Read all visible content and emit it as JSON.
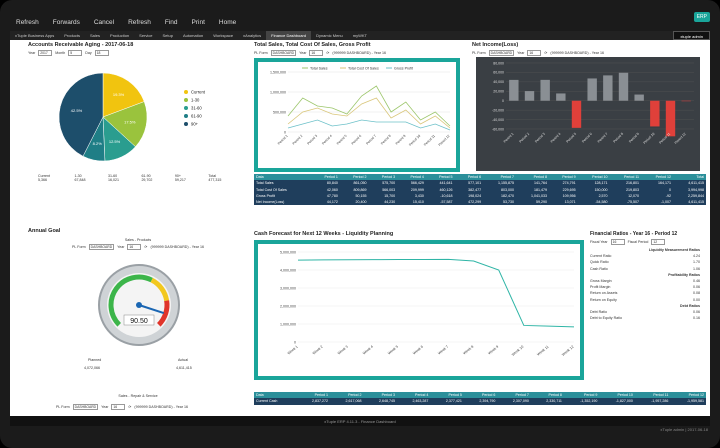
{
  "nav": {
    "refresh": "Refresh",
    "forwards": "Forwards",
    "cancel": "Cancel",
    "refresh2": "Refresh",
    "find": "Find",
    "print": "Print",
    "home": "Home"
  },
  "badge": "ERP",
  "tabs": [
    "xTuple Business Apps",
    "Products",
    "Sales",
    "Production",
    "Service",
    "Setup",
    "Automation",
    "Workspace",
    "xAnalytics",
    "Finance Dashboard",
    "Dynamic Menu",
    "myWKT"
  ],
  "user": "xtuple admin",
  "ar": {
    "title": "Accounts Receivable Aging - 2017-06-18",
    "year_label": "Year",
    "year": "2017",
    "month_label": "Month",
    "month": "5",
    "day_label": "Day",
    "day": "18",
    "legend": [
      "Current",
      "1-30",
      "31-60",
      "61-90",
      "90+"
    ],
    "slices": [
      {
        "label": "Current",
        "value": "5,366",
        "pct": "19.3%"
      },
      {
        "label": "1-30",
        "value": "67,848",
        "pct": "17.5%"
      },
      {
        "label": "31-60",
        "value": "16,021",
        "pct": "12.5%"
      },
      {
        "label": "61-90",
        "value": "29,702",
        "pct": "8.2%"
      },
      {
        "label": "90+",
        "value": "59,217",
        "pct": "42.5%"
      }
    ],
    "cols": [
      "Current",
      "1-30",
      "31-60",
      "61-90",
      "90+",
      "Total"
    ],
    "vals": [
      "5,366",
      "67,848",
      "16,021",
      "29,702",
      "59,217",
      "477,315"
    ]
  },
  "sales": {
    "title": "Total Sales, Total Cost Of Sales, Gross Profit",
    "pl_label": "PL Form",
    "pl": "DASHBOARD",
    "year_label": "Year",
    "year": "16",
    "info": "(999999 DASHBOARD) - Year 16",
    "legend": [
      "Total Sales",
      "Total Cost Of Sales",
      "Gross Profit"
    ],
    "y_ticks": [
      "1,500,000",
      "1,000,000",
      "500,000",
      "0"
    ]
  },
  "net": {
    "title": "Net Income(Loss)",
    "pl_label": "PL Form",
    "pl": "DASHBOARD",
    "year_label": "Year",
    "year": "16",
    "info": "(999999 DASHBOARD) - Year 16",
    "y_ticks": [
      "80,000",
      "60,000",
      "40,000",
      "20,000",
      "0",
      "-20,000",
      "-40,000",
      "-60,000"
    ]
  },
  "ft": {
    "head": [
      "Data",
      "Period 1",
      "Period 2",
      "Period 3",
      "Period 4",
      "Period 5",
      "Period 6",
      "Period 7",
      "Period 8",
      "Period 9",
      "Period 10",
      "Period 11",
      "Period 12",
      "Total"
    ],
    "rows": [
      {
        "name": "Total Sales",
        "v": [
          "80,840",
          "861,050",
          "575,700",
          "566,429",
          "441,641",
          "577,101",
          "1,155,875",
          "141,764",
          "274,791",
          "128,171",
          "216,801",
          "164,171",
          "4,611,415"
        ]
      },
      {
        "name": "Total Cost Of Sales",
        "v": [
          "42,060",
          "809,869",
          "566,003",
          "209,999",
          "460,126",
          "382,477",
          "803,000",
          "181,479",
          "229,695",
          "150,000",
          "219,803",
          "0",
          "3,994,998"
        ]
      },
      {
        "name": "Gross Profit",
        "v": [
          "47,780",
          "50,155",
          "15,700",
          "3,430",
          "-10,618",
          "198,024",
          "182,470",
          "1,041,033",
          "109,956",
          "2,570",
          "12,070",
          "-92",
          "2,259,844"
        ]
      },
      {
        "name": "Net Income(Loss)",
        "v": [
          "44,172",
          "20,400",
          "44,230",
          "15,410",
          "-57,587",
          "472,299",
          "53,730",
          "59,290",
          "13,071",
          "-54,580",
          "-75,507",
          "-1,007",
          "4,611,415"
        ]
      }
    ]
  },
  "annual": {
    "title": "Annual Goal",
    "sub": "Sales - Products",
    "pl_label": "PL Form",
    "pl": "DASHBOARD",
    "year_label": "Year",
    "year": "16",
    "info": "(999999 DASHBOARD) - Year 16",
    "gauge": "90.50",
    "pct_of_max": 0.9,
    "planned_label": "Planned",
    "actual_label": "Actual",
    "planned": "4,072,066",
    "actual": "4,611,415"
  },
  "annual2": {
    "sub": "Sales - Repair & Service",
    "pl_label": "PL Form",
    "pl": "DASHBOARD",
    "year_label": "Year",
    "year": "16",
    "info": "(999999 DASHBOARD) - Year 16"
  },
  "cash": {
    "title": "Cash Forecast for Next 12 Weeks - Liquidity Planning",
    "y_ticks": [
      "5,000,000",
      "4,000,000",
      "3,000,000",
      "2,000,000",
      "1,000,000",
      "0"
    ],
    "weeks": [
      "Week 1",
      "Week 2",
      "Week 3",
      "Week 4",
      "Week 5",
      "Week 6",
      "Week 7",
      "Week 8",
      "Week 9",
      "Week 10",
      "Week 11",
      "Week 12"
    ],
    "values": [
      4550000,
      4560000,
      4570000,
      4575000,
      4580000,
      4585000,
      4590000,
      4500000,
      4000000,
      920000,
      880000,
      840000
    ],
    "table_head": [
      "Data",
      "Period 1",
      "Period 2",
      "Period 3",
      "Period 4",
      "Period 5",
      "Period 6",
      "Period 7",
      "Period 8",
      "Period 9",
      "Period 10",
      "Period 11",
      "Period 12"
    ],
    "table_row": {
      "name": "Current Cash",
      "v": [
        "2,837,272",
        "2,617,068",
        "2,648,745",
        "2,463,287",
        "2,377,421",
        "2,394,790",
        "2,307,090",
        "2,330,711",
        "-1,352,190",
        "-1,827,000",
        "-1,957,286",
        "-1,959,581"
      ]
    }
  },
  "ratios": {
    "title": "Financial Ratios - Year 16 - Period 12",
    "fy_label": "Fiscal Year",
    "fy": "16",
    "fp_label": "Fiscal Period",
    "fp": "12",
    "sections": [
      {
        "name": "Liquidity Measurement Ratios",
        "items": [
          [
            "Current Ratio",
            "4.24"
          ],
          [
            "Quick Ratio",
            "1.70"
          ],
          [
            "Cash Ratio",
            "1.06"
          ]
        ]
      },
      {
        "name": "Profitability Ratios",
        "items": [
          [
            "Gross Margin",
            "0.46"
          ],
          [
            "Profit Margin",
            "0.06"
          ],
          [
            "Return on Assets",
            "0.08"
          ],
          [
            "Return on Equity",
            "0.00"
          ]
        ]
      },
      {
        "name": "Debt Ratios",
        "items": [
          [
            "Debt Ratio",
            "0.06"
          ],
          [
            "Debt to Equity Ratio",
            "0.16"
          ]
        ]
      }
    ]
  },
  "status": "xTuple ERP 4.11.3 - Finance Dashboard",
  "corner": "xTuple admin | 2017-06-18",
  "chart_data": [
    {
      "type": "pie",
      "title": "Accounts Receivable Aging - 2017-06-18",
      "categories": [
        "Current",
        "1-30",
        "31-60",
        "61-90",
        "90+"
      ],
      "values": [
        19.3,
        17.5,
        12.5,
        8.2,
        42.5
      ]
    },
    {
      "type": "line",
      "title": "Total Sales, Total Cost Of Sales, Gross Profit",
      "categories": [
        "Period 1",
        "Period 2",
        "Period 3",
        "Period 4",
        "Period 5",
        "Period 6",
        "Period 7",
        "Period 8",
        "Period 9",
        "Period 10",
        "Period 11",
        "Period 12"
      ],
      "series": [
        {
          "name": "Total Sales",
          "values": [
            400000,
            850000,
            650000,
            600000,
            450000,
            900000,
            1150000,
            500000,
            750000,
            300000,
            500000,
            150000
          ]
        },
        {
          "name": "Total Cost Of Sales",
          "values": [
            200000,
            500000,
            600000,
            450000,
            400000,
            700000,
            850000,
            350000,
            550000,
            200000,
            400000,
            100000
          ]
        },
        {
          "name": "Gross Profit",
          "values": [
            100000,
            200000,
            300000,
            150000,
            200000,
            300000,
            250000,
            250000,
            250000,
            100000,
            200000,
            50000
          ]
        }
      ],
      "ylim": [
        0,
        1500000
      ]
    },
    {
      "type": "bar",
      "title": "Net Income(Loss)",
      "categories": [
        "Period 1",
        "Period 2",
        "Period 3",
        "Period 4",
        "Period 5",
        "Period 6",
        "Period 7",
        "Period 8",
        "Period 9",
        "Period 10",
        "Period 11",
        "Period 12"
      ],
      "values": [
        44172,
        20400,
        44230,
        15410,
        -57587,
        47229,
        53730,
        59290,
        13071,
        -54580,
        -75507,
        -1007
      ],
      "ylim": [
        -60000,
        80000
      ]
    },
    {
      "type": "line",
      "title": "Cash Forecast for Next 12 Weeks - Liquidity Planning",
      "categories": [
        "Week 1",
        "Week 2",
        "Week 3",
        "Week 4",
        "Week 5",
        "Week 6",
        "Week 7",
        "Week 8",
        "Week 9",
        "Week 10",
        "Week 11",
        "Week 12"
      ],
      "values": [
        4550000,
        4560000,
        4570000,
        4575000,
        4580000,
        4585000,
        4590000,
        4500000,
        4000000,
        920000,
        880000,
        840000
      ],
      "ylim": [
        0,
        5000000
      ]
    }
  ]
}
